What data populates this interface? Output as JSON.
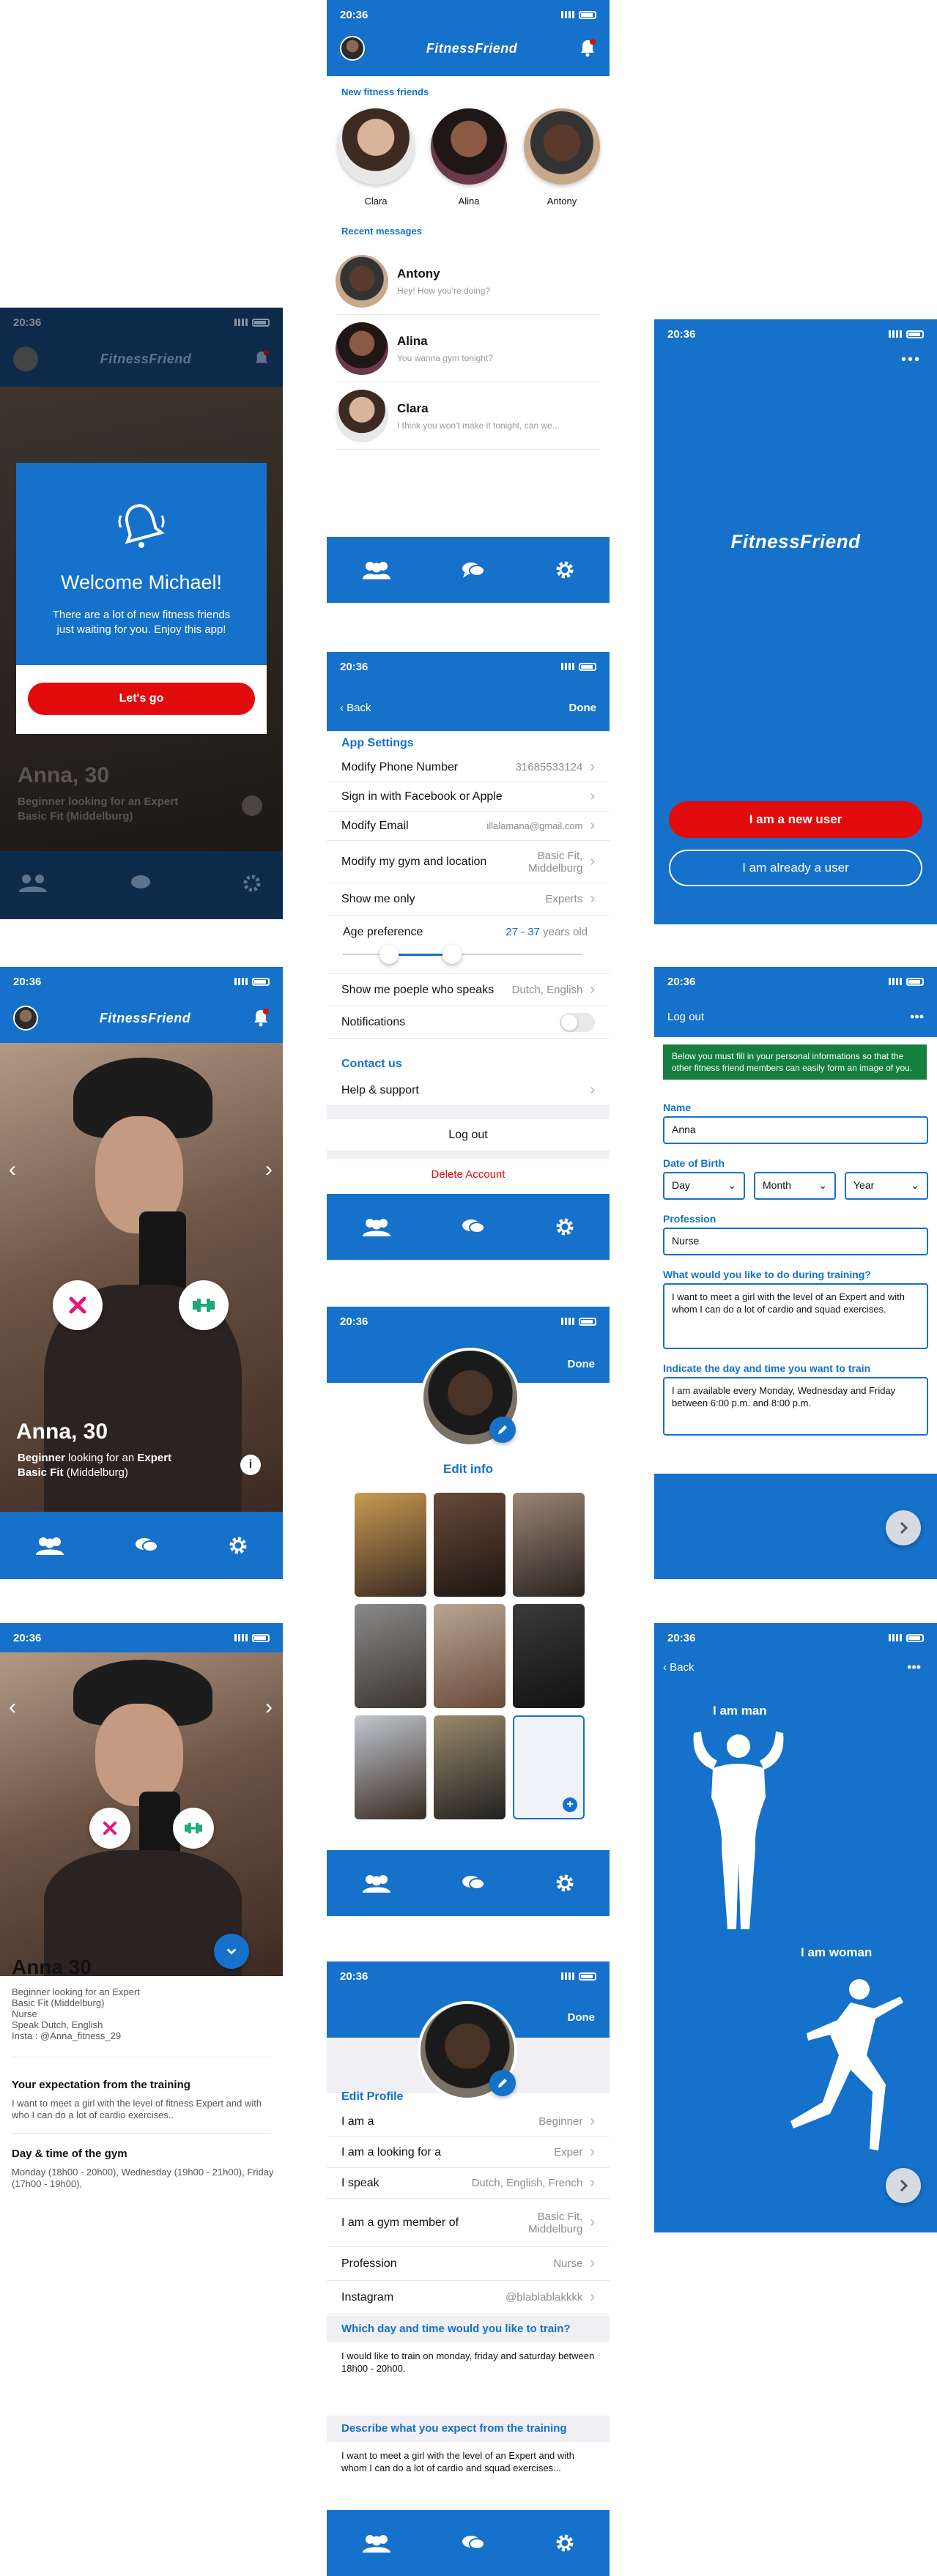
{
  "status": {
    "time": "20:36"
  },
  "brand": "FitnessFriend",
  "home": {
    "new_friends_label": "New fitness friends",
    "friends": [
      {
        "name": "Clara"
      },
      {
        "name": "Alina"
      },
      {
        "name": "Antony"
      }
    ],
    "recent_label": "Recent messages",
    "messages": [
      {
        "name": "Antony",
        "preview": "Hey! How you're doing?"
      },
      {
        "name": "Alina",
        "preview": "You wanna gym tonight?"
      },
      {
        "name": "Clara",
        "preview": "I think you won't make it tonight, can we..."
      }
    ]
  },
  "welcome": {
    "title": "Welcome Michael!",
    "body": "There are a lot of new fitness friends just waiting for you. Enjoy this app!",
    "cta": "Let's go",
    "bg_name": "Anna, 30",
    "bg_line1": "Beginner looking for an Expert",
    "bg_line2": "Basic Fit (Middelburg)"
  },
  "splash": {
    "cta_new": "I am a new user",
    "cta_existing": "I am already a user"
  },
  "settings": {
    "back": "Back",
    "done": "Done",
    "app_settings": "App Settings",
    "rows": [
      {
        "label": "Modify Phone Number",
        "value": "31685533124"
      },
      {
        "label": "Sign in with Facebook or Apple",
        "value": ""
      },
      {
        "label": "Modify Email",
        "value": "illalamana@gmail.com"
      },
      {
        "label": "Modify my gym and location",
        "value": "Basic Fit, Middelburg"
      },
      {
        "label": "Show me only",
        "value": "Experts"
      }
    ],
    "age_label": "Age preference",
    "age_range": "27 - 37",
    "age_unit": "years old",
    "speaks_label": "Show me poeple who speaks",
    "speaks_value": "Dutch, English",
    "notifications_label": "Notifications",
    "contact_label": "Contact us",
    "help_label": "Help & support",
    "logout": "Log out",
    "delete": "Delete Account"
  },
  "profile_card": {
    "name": "Anna, 30",
    "level_pre": "Beginner",
    "level_mid": " looking for an ",
    "level_target": "Expert",
    "gym_name": "Basic Fit",
    "gym_city": " (Middelburg)"
  },
  "onboarding": {
    "logout": "Log out",
    "intro": "Below you must fill in your personal informations so that the other fitness friend members can easily form an image of you.",
    "name_label": "Name",
    "name_value": "Anna",
    "dob_label": "Date of Birth",
    "dob_day": "Day",
    "dob_month": "Month",
    "dob_year": "Year",
    "profession_label": "Profession",
    "profession_value": "Nurse",
    "training_label": "What would you like to do during training?",
    "training_value": "I want to meet a girl with the level of an Expert and with whom I can do a lot of cardio and squad exercises.",
    "schedule_label": "Indicate the day and time you want to train",
    "schedule_value": "I am available every Monday, Wednesday and Friday between 6:00 p.m. and 8:00 p.m."
  },
  "edit_photos": {
    "done": "Done",
    "edit_info": "Edit info"
  },
  "detail": {
    "name": "Anna 30",
    "lines": [
      "Beginner looking for an Expert",
      "Basic Fit (Middelburg)",
      "Nurse",
      "Speak Dutch, English",
      "Insta : @Anna_fitness_29"
    ],
    "expect_title": "Your expectation from the training",
    "expect_text": "I want to meet a girl with the level of fitness Expert and with who I can do a lot of cardio exercises..",
    "schedule_title": "Day & time of the gym",
    "schedule_text": "Monday (18h00 - 20h00), Wednesday (19h00 - 21h00), Friday (17h00 - 19h00),"
  },
  "gender": {
    "back": "Back",
    "man": "I am man",
    "woman": "I am woman"
  },
  "edit_profile": {
    "done": "Done",
    "title": "Edit Profile",
    "rows": [
      {
        "label": "I am a",
        "value": "Beginner"
      },
      {
        "label": "I am a looking for a",
        "value": "Exper"
      },
      {
        "label": "I speak",
        "value": "Dutch, English, French"
      },
      {
        "label": "I am a gym member of",
        "value": "Basic Fit, Middelburg"
      },
      {
        "label": "Profession",
        "value": "Nurse"
      },
      {
        "label": "Instagram",
        "value": "@blablablakkkk"
      }
    ],
    "train_title": "Which day and time would you like to train?",
    "train_text": "I would like to train on monday, friday and saturday between 18h00 - 20h00.",
    "expect_title": "Describe what you expect from the training",
    "expect_text": "I want to meet a girl with the level of an Expert and with whom I can do a lot of cardio and squad exercises..."
  },
  "colors": {
    "brand_blue": "#1571c9",
    "red": "#e10b0b",
    "green": "#15803d",
    "pink": "#e8157a",
    "teal": "#1aa97a"
  },
  "icons": [
    "friends-icon",
    "chat-icon",
    "gear-icon",
    "bell-icon",
    "chevron-right-icon",
    "close-icon",
    "dumbbell-icon",
    "info-icon",
    "pencil-icon",
    "plus-icon"
  ]
}
